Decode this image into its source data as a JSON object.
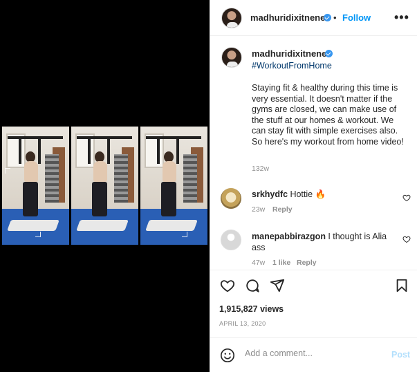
{
  "post": {
    "username": "madhuridixitnene",
    "follow_label": "Follow",
    "separator": "•",
    "more_label": "•••",
    "hashtag": "#WorkoutFromHome",
    "caption": "Staying fit & healthy during this time is very essential. It doesn't matter if the gyms are closed, we can make use of the stuff at our homes & workout. We can stay fit with simple exercises also. So here's my workout from home video!",
    "caption_age": "132w",
    "views": "1,915,827 views",
    "date": "APRIL 13, 2020"
  },
  "comments": [
    {
      "username": "srkhydfc",
      "text": "Hottie 🔥",
      "age": "23w",
      "reply_label": "Reply"
    },
    {
      "username": "manepabbirazgon",
      "text": "I thought is Alia ass",
      "age": "47w",
      "likes": "1 like",
      "reply_label": "Reply"
    }
  ],
  "add_comment": {
    "placeholder": "Add a comment...",
    "post_label": "Post"
  },
  "colors": {
    "link_blue": "#0095f6",
    "hashtag_blue": "#00376b",
    "muted": "#8e8e8e",
    "post_disabled": "#b2dffc"
  },
  "icons": [
    "verified-icon",
    "more-options-icon",
    "heart-icon",
    "comment-icon",
    "share-icon",
    "bookmark-icon",
    "emoji-icon"
  ]
}
